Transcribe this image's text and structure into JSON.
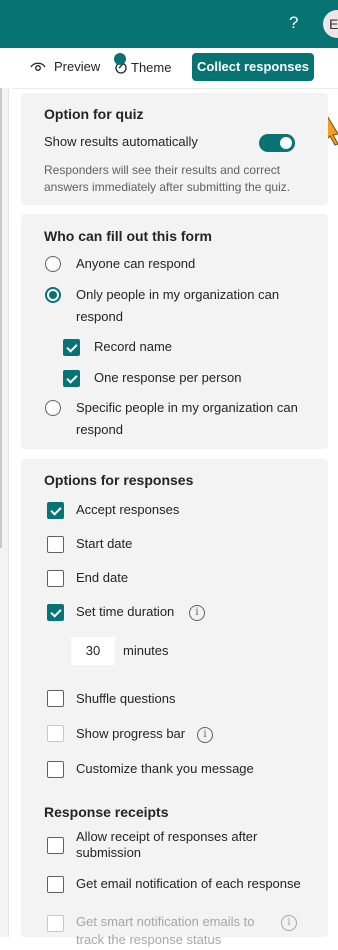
{
  "header": {
    "help": "?",
    "avatar": "E"
  },
  "toolbar": {
    "preview": "Preview",
    "theme": "Theme",
    "collect": "Collect responses"
  },
  "quiz": {
    "heading": "Option for quiz",
    "show_results": "Show results automatically",
    "show_results_on": true,
    "description_line1": "Responders will see their results and correct",
    "description_line2": "answers immediately after submitting the quiz."
  },
  "who": {
    "heading": "Who can fill out this form",
    "anyone": "Anyone can respond",
    "org_line1": "Only people in my organization can",
    "org_line2": "respond",
    "record_name": "Record name",
    "one_response": "One response per person",
    "specific_line1": "Specific people in my organization can",
    "specific_line2": "respond"
  },
  "responses": {
    "heading": "Options for responses",
    "accept": "Accept responses",
    "start_date": "Start date",
    "end_date": "End date",
    "time_duration": "Set time duration",
    "minutes_value": "30",
    "minutes_label": "minutes",
    "shuffle": "Shuffle questions",
    "progress_bar": "Show progress bar",
    "thank_you": "Customize thank you message"
  },
  "receipts": {
    "heading": "Response receipts",
    "allow_line1": "Allow receipt of responses after",
    "allow_line2": "submission",
    "email_notify": "Get email notification of each response",
    "smart_line1": "Get smart notification emails to",
    "smart_line2": "track the response status"
  },
  "colors": {
    "accent": "#077473",
    "card": "#f3f3f3"
  }
}
